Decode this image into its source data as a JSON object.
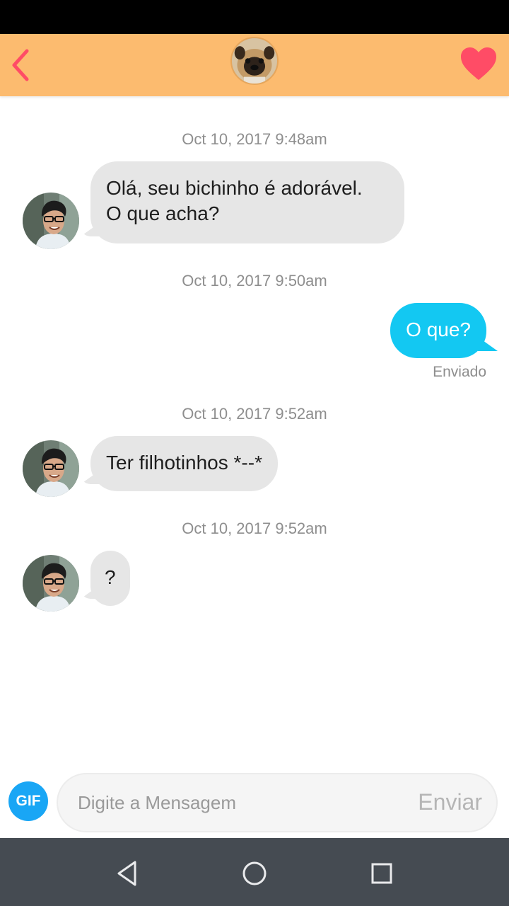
{
  "header": {
    "back_icon": "chevron-left-icon",
    "like_icon": "heart-icon",
    "accent_color": "#fcbb6f",
    "heart_color": "#ff4c66"
  },
  "messages": [
    {
      "timestamp": "Oct 10, 2017 9:48am",
      "direction": "incoming",
      "lines": [
        "Olá, seu bichinho é adorável.",
        "O que acha?"
      ]
    },
    {
      "timestamp": "Oct 10, 2017 9:50am",
      "direction": "outgoing",
      "text": "O que?",
      "status": "Enviado"
    },
    {
      "timestamp": "Oct 10, 2017 9:52am",
      "direction": "incoming",
      "text": "Ter filhotinhos *--*"
    },
    {
      "timestamp": "Oct 10, 2017 9:52am",
      "direction": "incoming",
      "text": "?"
    }
  ],
  "composer": {
    "gif_label": "GIF",
    "placeholder": "Digite a Mensagem",
    "send_label": "Enviar"
  },
  "navbar": {
    "icons": [
      "back-triangle-icon",
      "home-circle-icon",
      "recents-square-icon"
    ]
  },
  "colors": {
    "incoming_bubble": "#e6e6e6",
    "outgoing_bubble": "#13c8f2",
    "gif_button": "#19a6f5"
  }
}
